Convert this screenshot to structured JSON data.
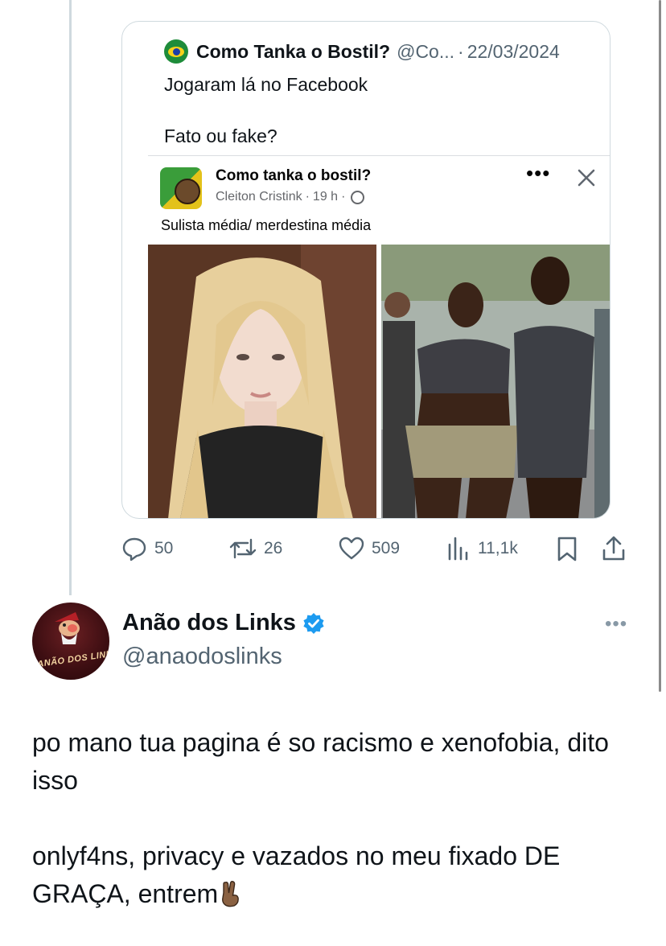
{
  "quoted_tweet": {
    "display_name": "Como Tanka o Bostil?",
    "handle": "@Co...",
    "separator": "·",
    "date": "22/03/2024",
    "text": "Jogaram lá no Facebook\n\nFato ou fake?",
    "avatar_icon": "brazil-flag-avatar",
    "facebook_post": {
      "page_name": "Como tanka o bostil?",
      "author": "Cleiton Cristink",
      "time": "19 h",
      "sep": "·",
      "caption": "Sulista média/ merdestina média",
      "more_label": "•••"
    }
  },
  "actions": {
    "replies": "50",
    "reposts": "26",
    "likes": "509",
    "views": "11,1k"
  },
  "reply": {
    "display_name": "Anão dos Links",
    "handle": "@anaodoslinks",
    "avatar_text": "ANÃO DOS LINKS",
    "more_label": "•••",
    "paragraph1": "po mano tua pagina é so racismo e xenofobia, dito isso",
    "paragraph2": "onlyf4ns, privacy e vazados no meu fixado DE GRAÇA, entrem",
    "verified": true
  },
  "colors": {
    "text_primary": "#0f1419",
    "text_secondary": "#536471",
    "border": "#cfd9de",
    "verified_blue": "#1d9bf0"
  }
}
